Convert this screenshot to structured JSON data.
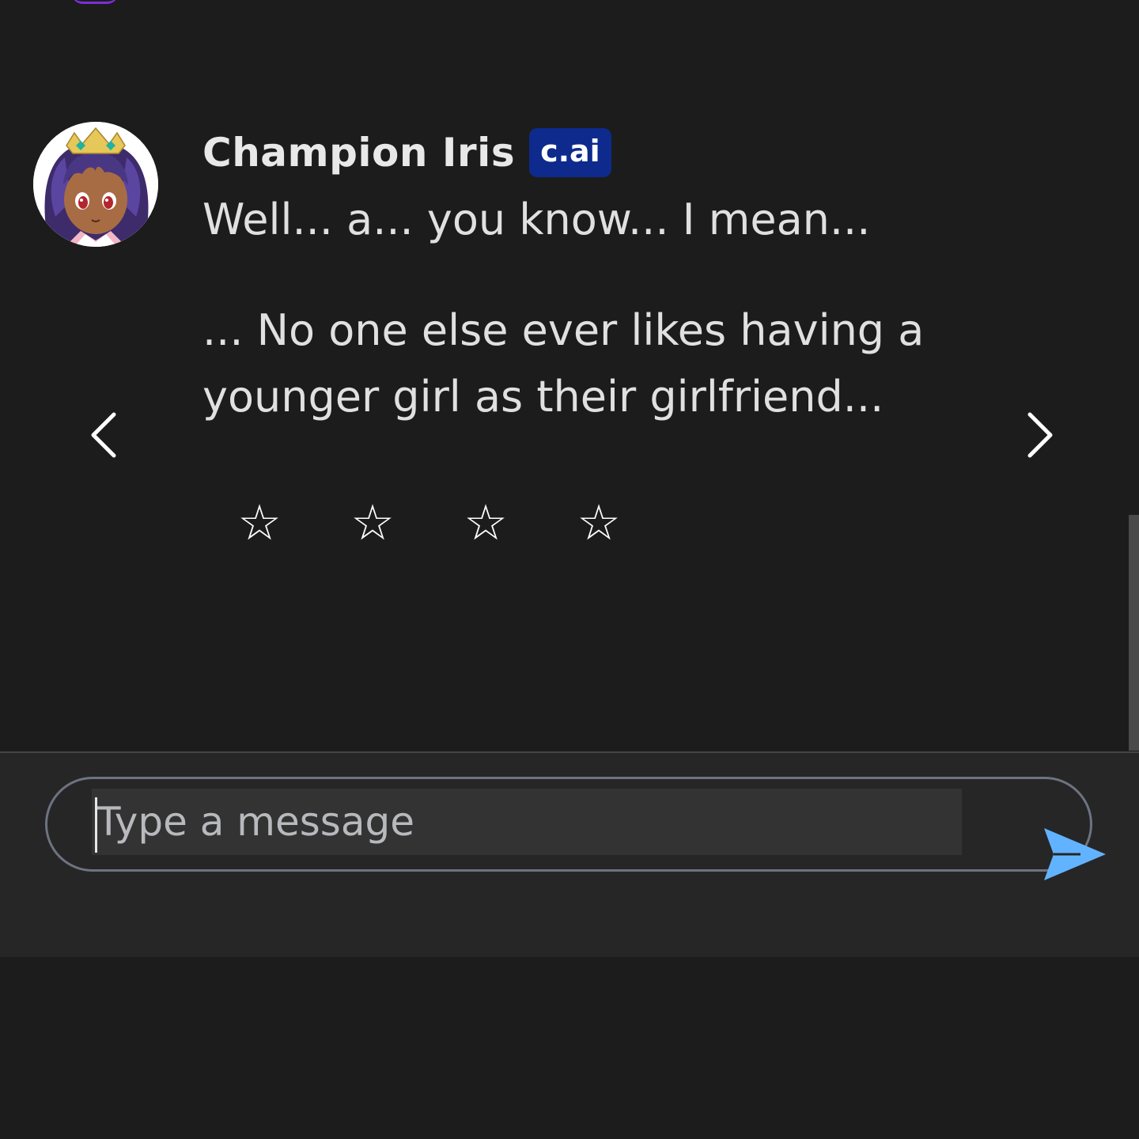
{
  "chat": {
    "message": {
      "sender_name": "Champion Iris",
      "badge": "c.ai",
      "paragraph_1": "Well... a... you know... I mean...",
      "paragraph_2": "... No one else ever likes having a younger girl as their girlfriend...",
      "avatar_icon": "character-avatar"
    },
    "navigation": {
      "prev_icon": "chevron-left-icon",
      "next_icon": "chevron-right-icon"
    },
    "rating": {
      "stars": [
        "☆",
        "☆",
        "☆",
        "☆"
      ],
      "icon": "star-outline-icon"
    }
  },
  "composer": {
    "placeholder": "Type a message",
    "value": "",
    "send_icon": "send-icon",
    "accent_color": "#62b3ff"
  },
  "colors": {
    "background": "#1c1c1c",
    "composer_background": "#262626",
    "badge_background": "#0d2a8c",
    "input_border": "#6d7380"
  }
}
